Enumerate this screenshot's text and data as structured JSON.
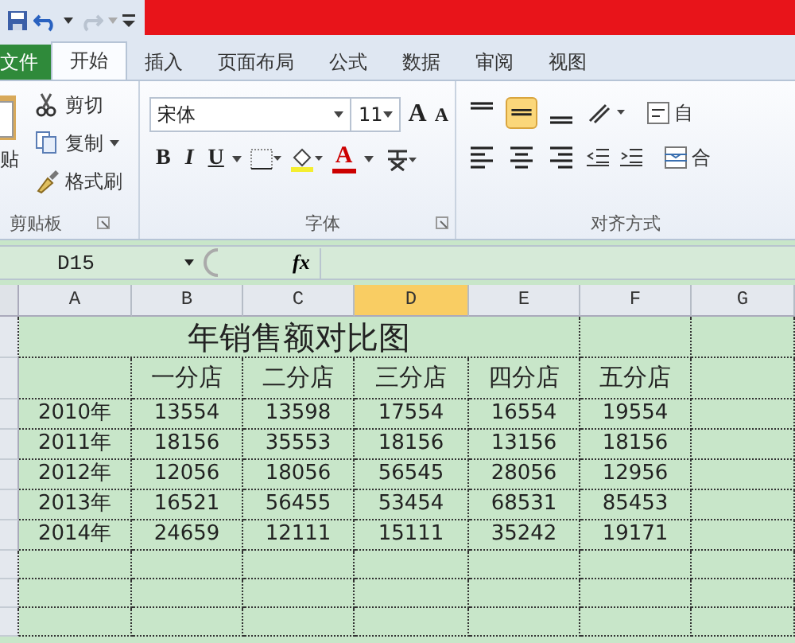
{
  "tabs": [
    {
      "label": "文件",
      "kind": "file",
      "selected": false
    },
    {
      "label": "开始",
      "kind": "tab",
      "selected": true
    },
    {
      "label": "插入",
      "kind": "tab",
      "selected": false
    },
    {
      "label": "页面布局",
      "kind": "tab",
      "selected": false
    },
    {
      "label": "公式",
      "kind": "tab",
      "selected": false
    },
    {
      "label": "数据",
      "kind": "tab",
      "selected": false
    },
    {
      "label": "审阅",
      "kind": "tab",
      "selected": false
    },
    {
      "label": "视图",
      "kind": "tab",
      "selected": false
    }
  ],
  "clipboard": {
    "paste_label": "贴",
    "items": [
      {
        "label": "剪切",
        "kind": "cut"
      },
      {
        "label": "复制",
        "kind": "copy"
      },
      {
        "label": "格式刷",
        "kind": "brush"
      }
    ],
    "label": "剪贴板"
  },
  "font": {
    "font_name": "宋体",
    "font_size": "11",
    "grow": "A",
    "shrink": "A",
    "bold": "B",
    "italic": "I",
    "underline": "U",
    "color_label": "A",
    "label": "字体"
  },
  "alignment": {
    "vertical": [
      {
        "kind": "top",
        "selected": false
      },
      {
        "kind": "middle",
        "selected": true
      },
      {
        "kind": "bottom",
        "selected": false
      }
    ],
    "horizontal": [
      {
        "kind": "left",
        "selected": false
      },
      {
        "kind": "center",
        "selected": false
      },
      {
        "kind": "right",
        "selected": false
      }
    ],
    "wrap_label": "自",
    "merge_label": "合",
    "label": "对齐方式"
  },
  "formula_bar": {
    "name_box": "D15",
    "fx": "fx"
  },
  "sheet": {
    "columns": [
      {
        "label": "A",
        "selected": false
      },
      {
        "label": "B",
        "selected": false
      },
      {
        "label": "C",
        "selected": false
      },
      {
        "label": "D",
        "selected": true
      },
      {
        "label": "E",
        "selected": false
      },
      {
        "label": "F",
        "selected": false
      },
      {
        "label": "G",
        "selected": false
      }
    ],
    "title": "年销售额对比图",
    "header": [
      "一分店",
      "二分店",
      "三分店",
      "四分店",
      "五分店"
    ],
    "rows": [
      [
        "2010年",
        "13554",
        "13598",
        "17554",
        "16554",
        "19554"
      ],
      [
        "2011年",
        "18156",
        "35553",
        "18156",
        "13156",
        "18156"
      ],
      [
        "2012年",
        "12056",
        "18056",
        "56545",
        "28056",
        "12956"
      ],
      [
        "2013年",
        "16521",
        "56455",
        "53454",
        "68531",
        "85453"
      ],
      [
        "2014年",
        "24659",
        "12111",
        "15111",
        "35242",
        "19171"
      ]
    ]
  }
}
